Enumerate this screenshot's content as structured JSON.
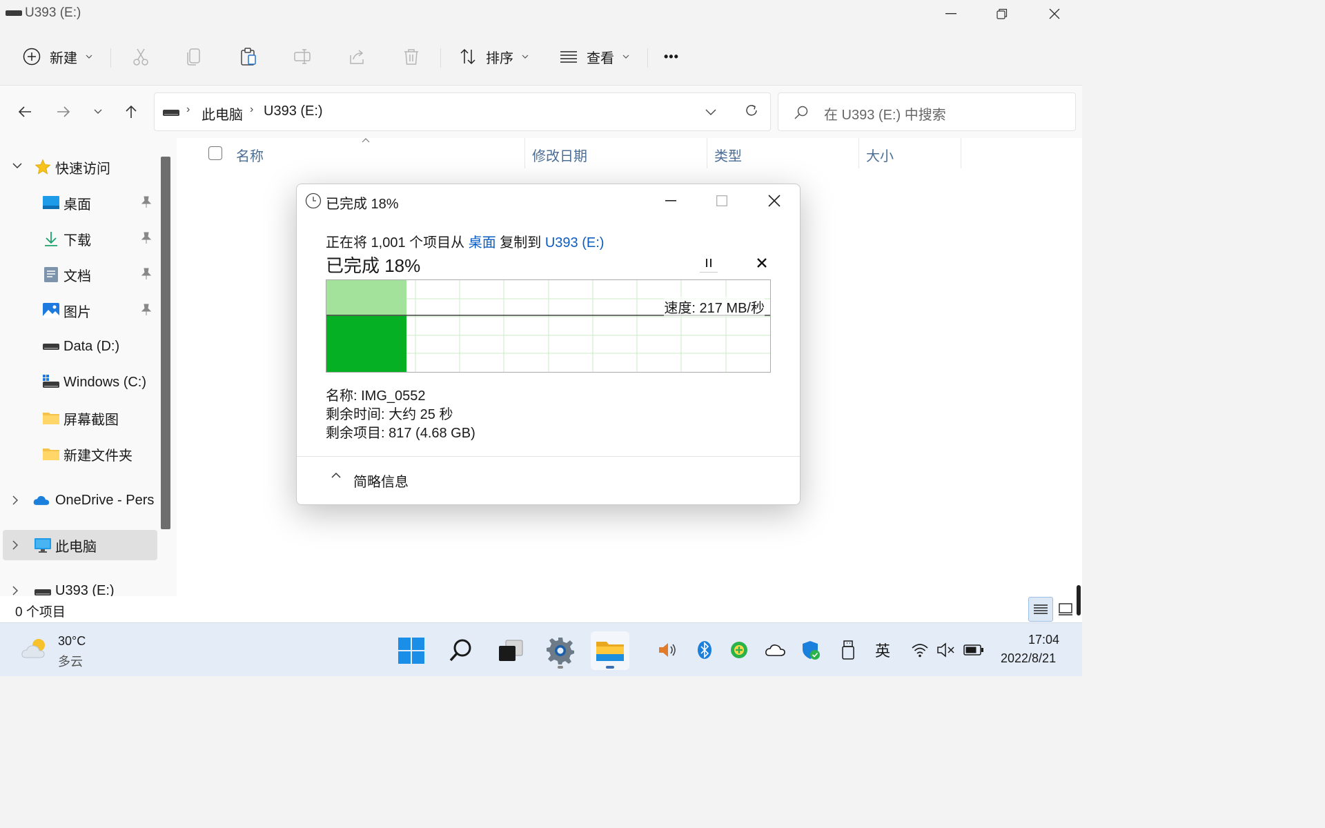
{
  "window": {
    "title": "U393 (E:)",
    "minimize": "—",
    "restore": "❐",
    "close": "✕"
  },
  "command_bar": {
    "new_label": "新建",
    "sort_label": "排序",
    "view_label": "查看",
    "more_label": "•••"
  },
  "address": {
    "root": "此电脑",
    "current": "U393 (E:)",
    "search_placeholder": "在 U393 (E:) 中搜索"
  },
  "sidebar": {
    "quick_access": "快速访问",
    "items": [
      {
        "label": "桌面",
        "icon": "desktop-icon",
        "pinned": true
      },
      {
        "label": "下载",
        "icon": "download-icon",
        "pinned": true
      },
      {
        "label": "文档",
        "icon": "document-icon",
        "pinned": true
      },
      {
        "label": "图片",
        "icon": "pictures-icon",
        "pinned": true
      },
      {
        "label": "Data (D:)",
        "icon": "drive-icon",
        "pinned": false
      },
      {
        "label": "Windows (C:)",
        "icon": "windows-drive-icon",
        "pinned": false
      },
      {
        "label": "屏幕截图",
        "icon": "folder-icon",
        "pinned": false
      },
      {
        "label": "新建文件夹",
        "icon": "folder-icon",
        "pinned": false
      }
    ],
    "onedrive": "OneDrive - Pers",
    "this_pc": "此电脑",
    "usb_drive": "U393 (E:)"
  },
  "columns": [
    "名称",
    "修改日期",
    "类型",
    "大小"
  ],
  "status": {
    "item_count": "0 个项目"
  },
  "copy_dialog": {
    "title": "已完成 18%",
    "message_prefix": "正在将 1,001 个项目从 ",
    "source": "桌面",
    "message_mid": " 复制到 ",
    "destination": "U393 (E:)",
    "progress_heading": "已完成 18%",
    "progress": 0.18,
    "speed": "速度: 217 MB/秒",
    "name_line": "名称:  IMG_0552",
    "time_line": "剩余时间:  大约 25 秒",
    "items_line": "剩余项目:  817 (4.68 GB)",
    "details_toggle": "简略信息"
  },
  "taskbar": {
    "temperature": "30°C",
    "condition": "多云",
    "ime": "英",
    "time": "17:04",
    "date": "2022/8/21"
  },
  "colors": {
    "accent": "#0b5cc1",
    "progress_fill": "#06b025",
    "progress_light": "#a2e29a",
    "grid": "#c8ecc4"
  }
}
